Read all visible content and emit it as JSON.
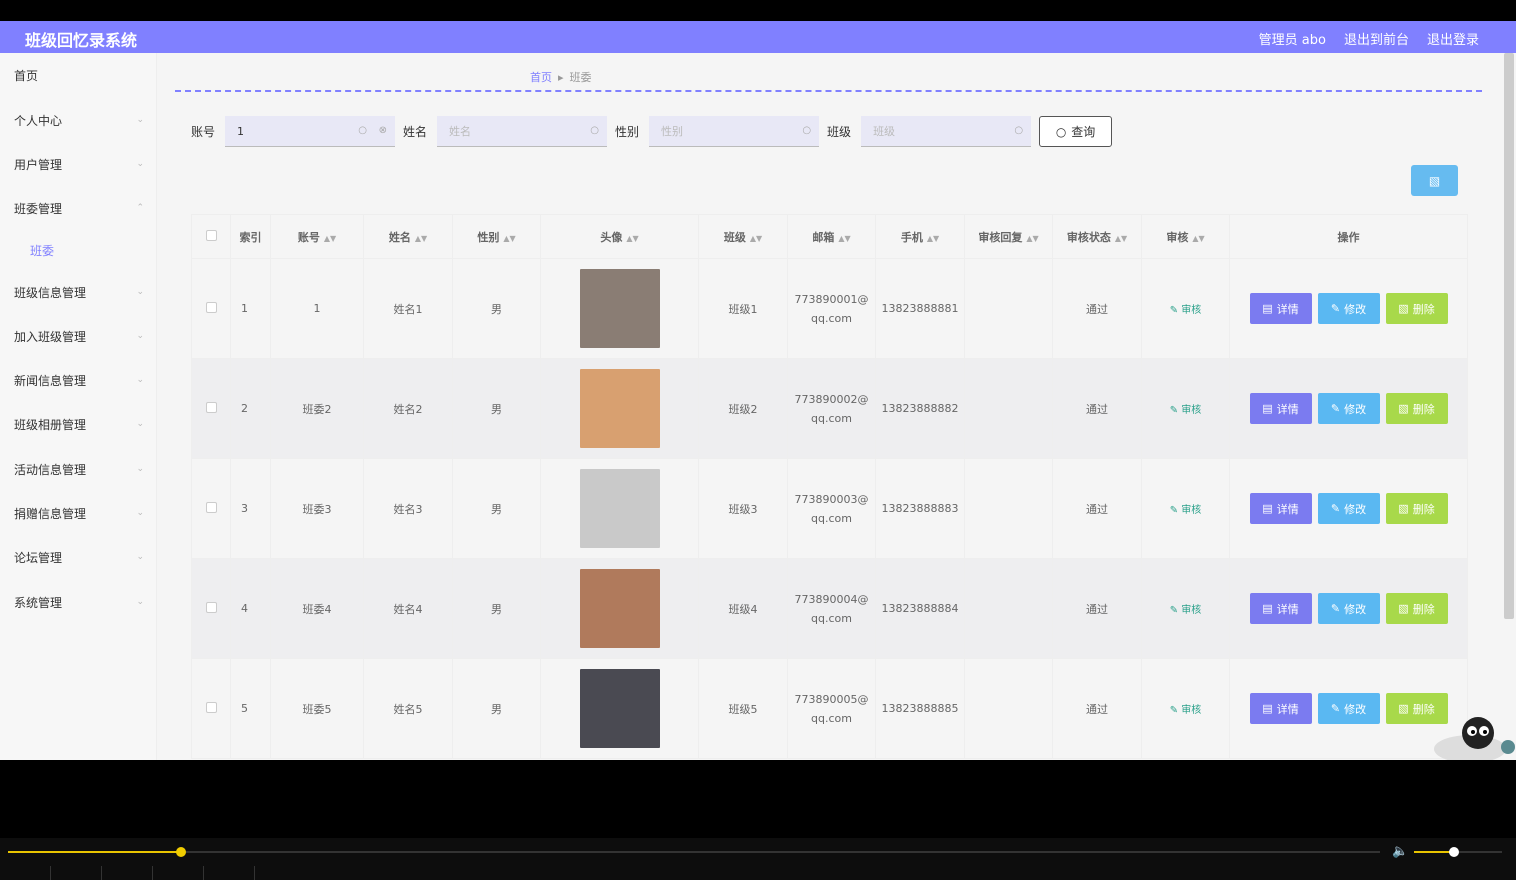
{
  "header": {
    "title": "班级回忆录系统",
    "admin": "管理员 abo",
    "to_front": "退出到前台",
    "logout": "退出登录"
  },
  "sidebar": {
    "items": [
      {
        "label": "首页",
        "expandable": false
      },
      {
        "label": "个人中心",
        "expandable": true
      },
      {
        "label": "用户管理",
        "expandable": true
      },
      {
        "label": "班委管理",
        "expandable": true,
        "expanded": true
      },
      {
        "label": "班委",
        "sub": true
      },
      {
        "label": "班级信息管理",
        "expandable": true
      },
      {
        "label": "加入班级管理",
        "expandable": true
      },
      {
        "label": "新闻信息管理",
        "expandable": true
      },
      {
        "label": "班级相册管理",
        "expandable": true
      },
      {
        "label": "活动信息管理",
        "expandable": true
      },
      {
        "label": "捐赠信息管理",
        "expandable": true
      },
      {
        "label": "论坛管理",
        "expandable": true
      },
      {
        "label": "系统管理",
        "expandable": true
      }
    ]
  },
  "breadcrumb": {
    "home": "首页",
    "current": "班委"
  },
  "search": {
    "account": {
      "label": "账号",
      "value": "1",
      "placeholder": ""
    },
    "name": {
      "label": "姓名",
      "placeholder": "姓名"
    },
    "gender": {
      "label": "性别",
      "placeholder": "性别"
    },
    "class": {
      "label": "班级",
      "placeholder": "班级"
    },
    "query_label": "查询"
  },
  "table": {
    "headers": [
      "索引",
      "账号",
      "姓名",
      "性别",
      "头像",
      "班级",
      "邮箱",
      "手机",
      "审核回复",
      "审核状态",
      "审核",
      "操作"
    ],
    "audit_label": "审核",
    "actions": {
      "detail": "详情",
      "edit": "修改",
      "delete": "删除"
    },
    "rows": [
      {
        "index": "1",
        "account": "1",
        "name": "姓名1",
        "gender": "男",
        "class": "班级1",
        "email_1": "773890001@",
        "email_2": "qq.com",
        "phone": "13823888881",
        "reply": "",
        "status": "通过",
        "avatar_color": "#8a7d74"
      },
      {
        "index": "2",
        "account": "班委2",
        "name": "姓名2",
        "gender": "男",
        "class": "班级2",
        "email_1": "773890002@",
        "email_2": "qq.com",
        "phone": "13823888882",
        "reply": "",
        "status": "通过",
        "avatar_color": "#d8a070"
      },
      {
        "index": "3",
        "account": "班委3",
        "name": "姓名3",
        "gender": "男",
        "class": "班级3",
        "email_1": "773890003@",
        "email_2": "qq.com",
        "phone": "13823888883",
        "reply": "",
        "status": "通过",
        "avatar_color": "#c9c9c9"
      },
      {
        "index": "4",
        "account": "班委4",
        "name": "姓名4",
        "gender": "男",
        "class": "班级4",
        "email_1": "773890004@",
        "email_2": "qq.com",
        "phone": "13823888884",
        "reply": "",
        "status": "通过",
        "avatar_color": "#b07a5c"
      },
      {
        "index": "5",
        "account": "班委5",
        "name": "姓名5",
        "gender": "男",
        "class": "班级5",
        "email_1": "773890005@",
        "email_2": "qq.com",
        "phone": "13823888885",
        "reply": "",
        "status": "通过",
        "avatar_color": "#4a4a52"
      }
    ]
  },
  "player": {
    "progress": 0.126,
    "volume": 0.45
  },
  "colors": {
    "accent": "#8080ff",
    "edit": "#5ab8f2",
    "delete": "#a8d94a"
  }
}
